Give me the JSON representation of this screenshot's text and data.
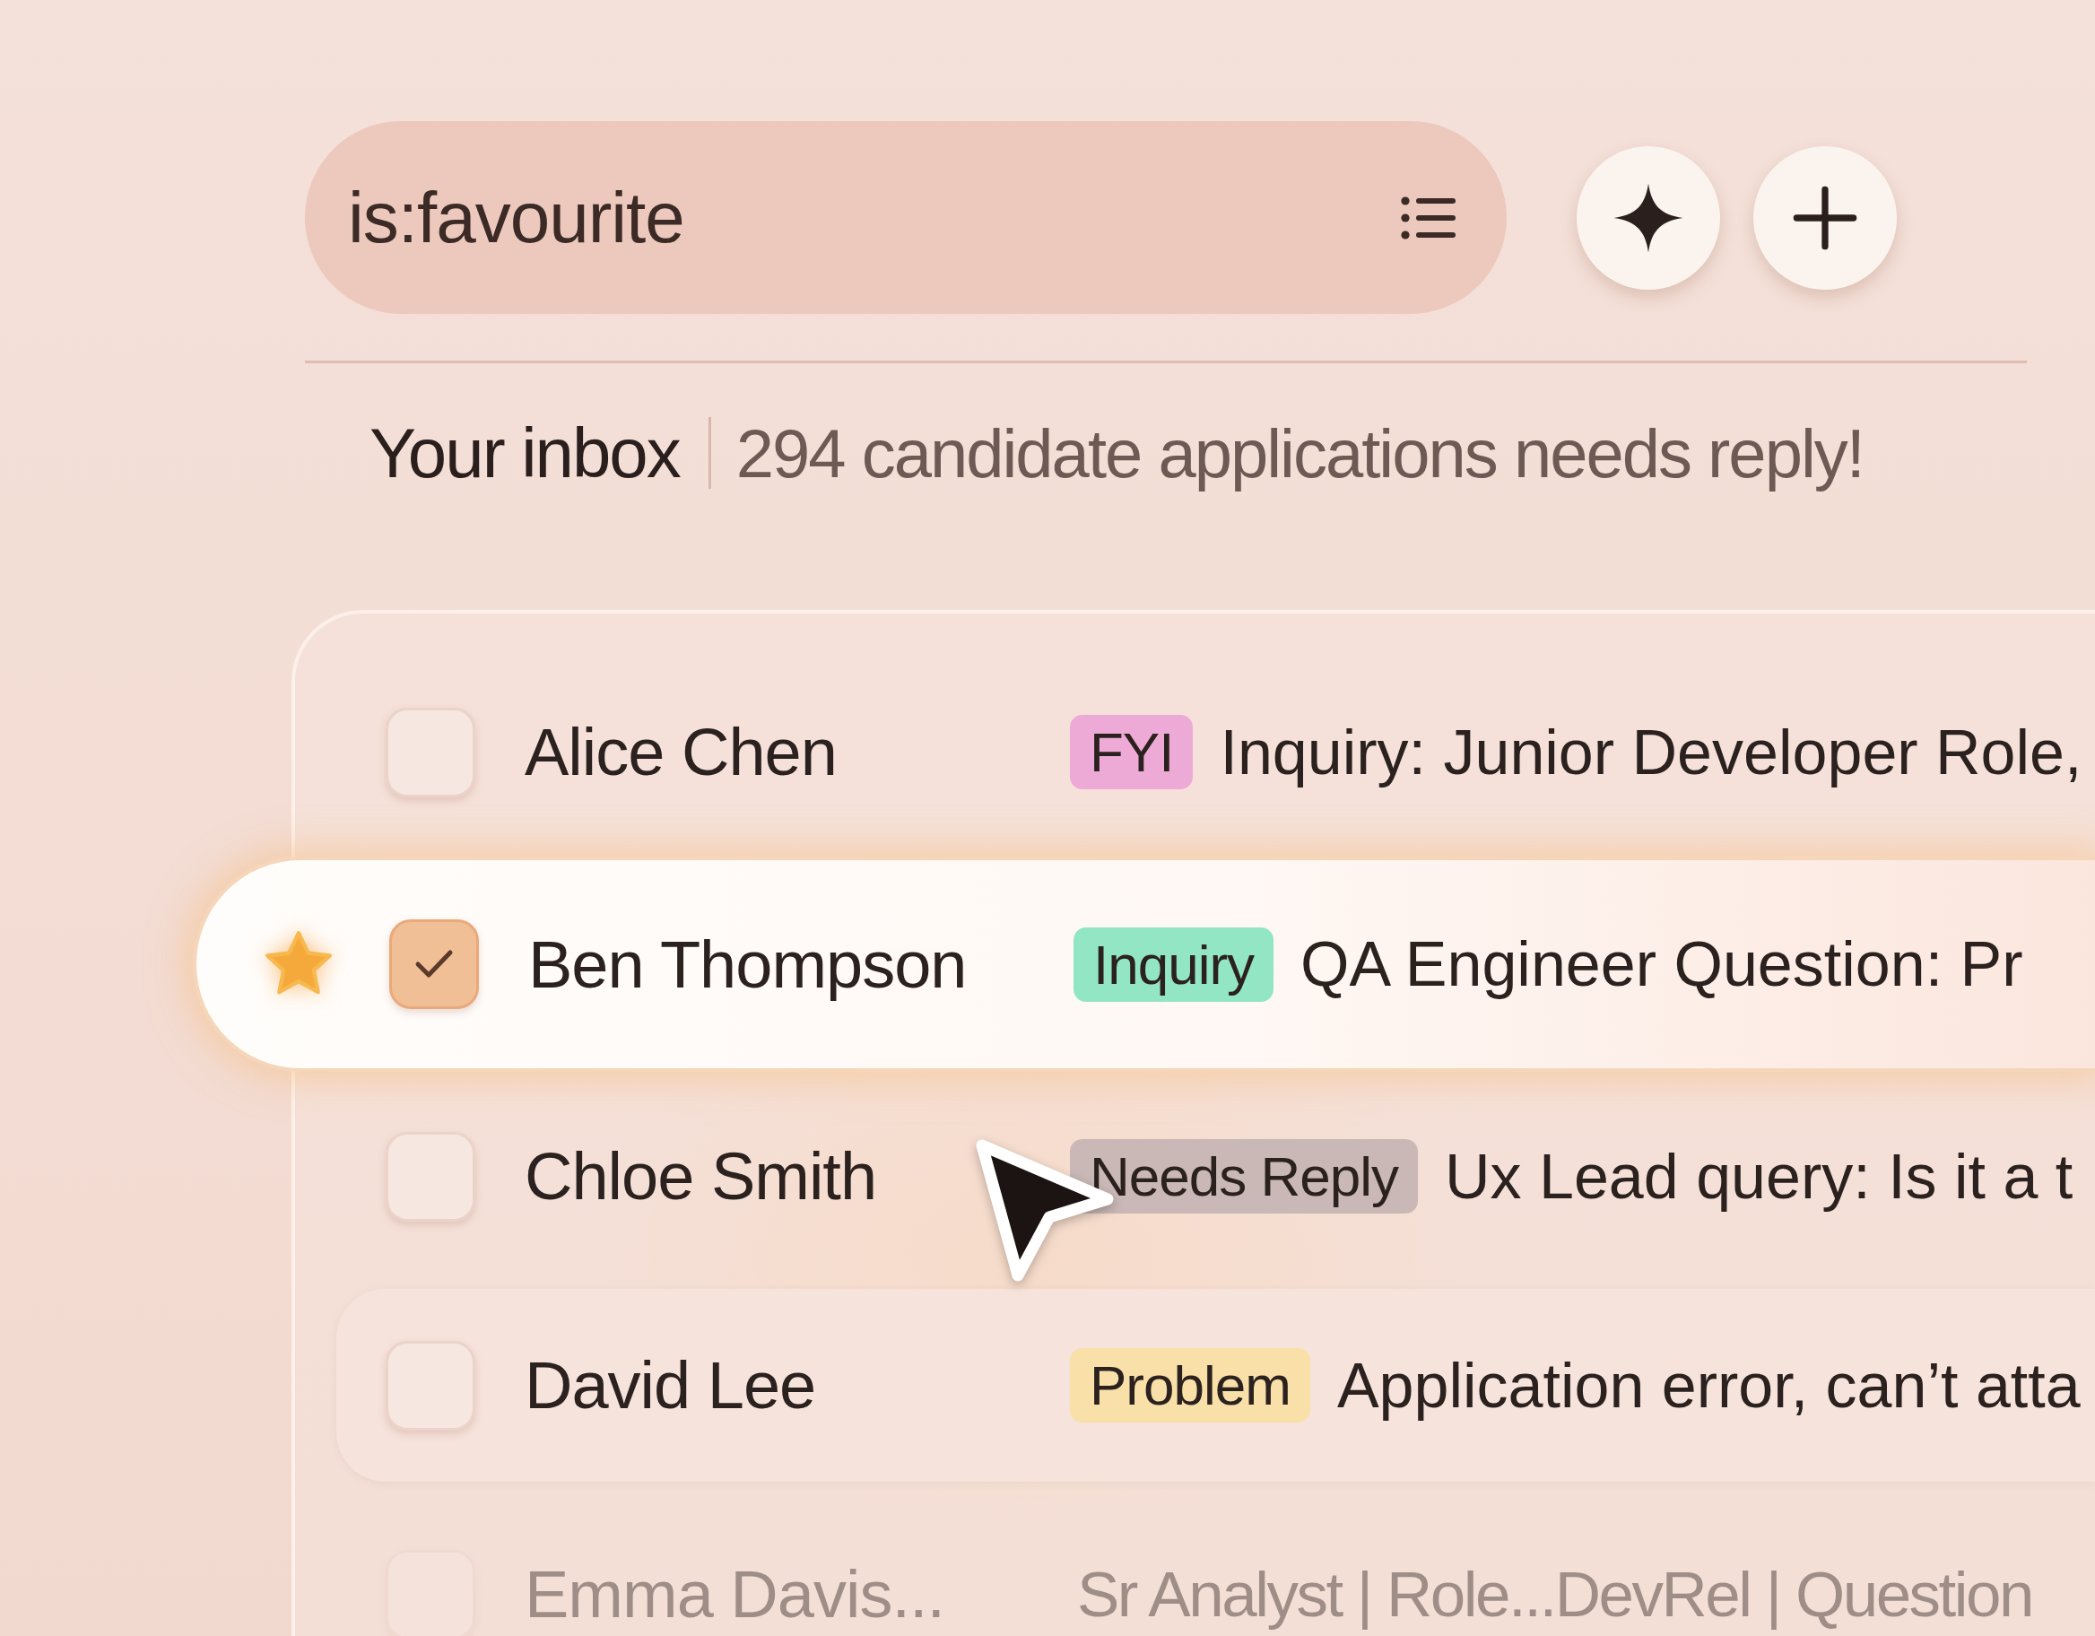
{
  "search": {
    "value": "is:favourite"
  },
  "inbox": {
    "title": "Your inbox",
    "summary": "294 candidate applications needs reply!"
  },
  "messages": [
    {
      "sender": "Alice Chen",
      "tag": {
        "label": "FYI",
        "color": "#eeaad6"
      },
      "subject": "Inquiry: Junior Developer Role,",
      "checked": false,
      "starred": false,
      "selected": false,
      "hovered": false,
      "dimmed": false
    },
    {
      "sender": "Ben Thompson",
      "tag": {
        "label": "Inquiry",
        "color": "#93e6c4"
      },
      "subject": "QA Engineer Question: Pr",
      "checked": true,
      "starred": true,
      "selected": true,
      "hovered": false,
      "dimmed": false
    },
    {
      "sender": "Chloe Smith",
      "tag": {
        "label": "Needs Reply",
        "color": "#c9b8b5"
      },
      "subject": "Ux Lead query: Is it a t",
      "checked": false,
      "starred": false,
      "selected": false,
      "hovered": false,
      "dimmed": false
    },
    {
      "sender": "David Lee",
      "tag": {
        "label": "Problem",
        "color": "#f8e0a8"
      },
      "subject": "Application error, can’t atta",
      "checked": false,
      "starred": false,
      "selected": false,
      "hovered": true,
      "dimmed": false
    },
    {
      "sender": "Emma Davis...",
      "subject": "Sr Analyst | Role...DevRel | Question",
      "checked": false,
      "starred": false,
      "selected": false,
      "hovered": false,
      "dimmed": true
    }
  ]
}
